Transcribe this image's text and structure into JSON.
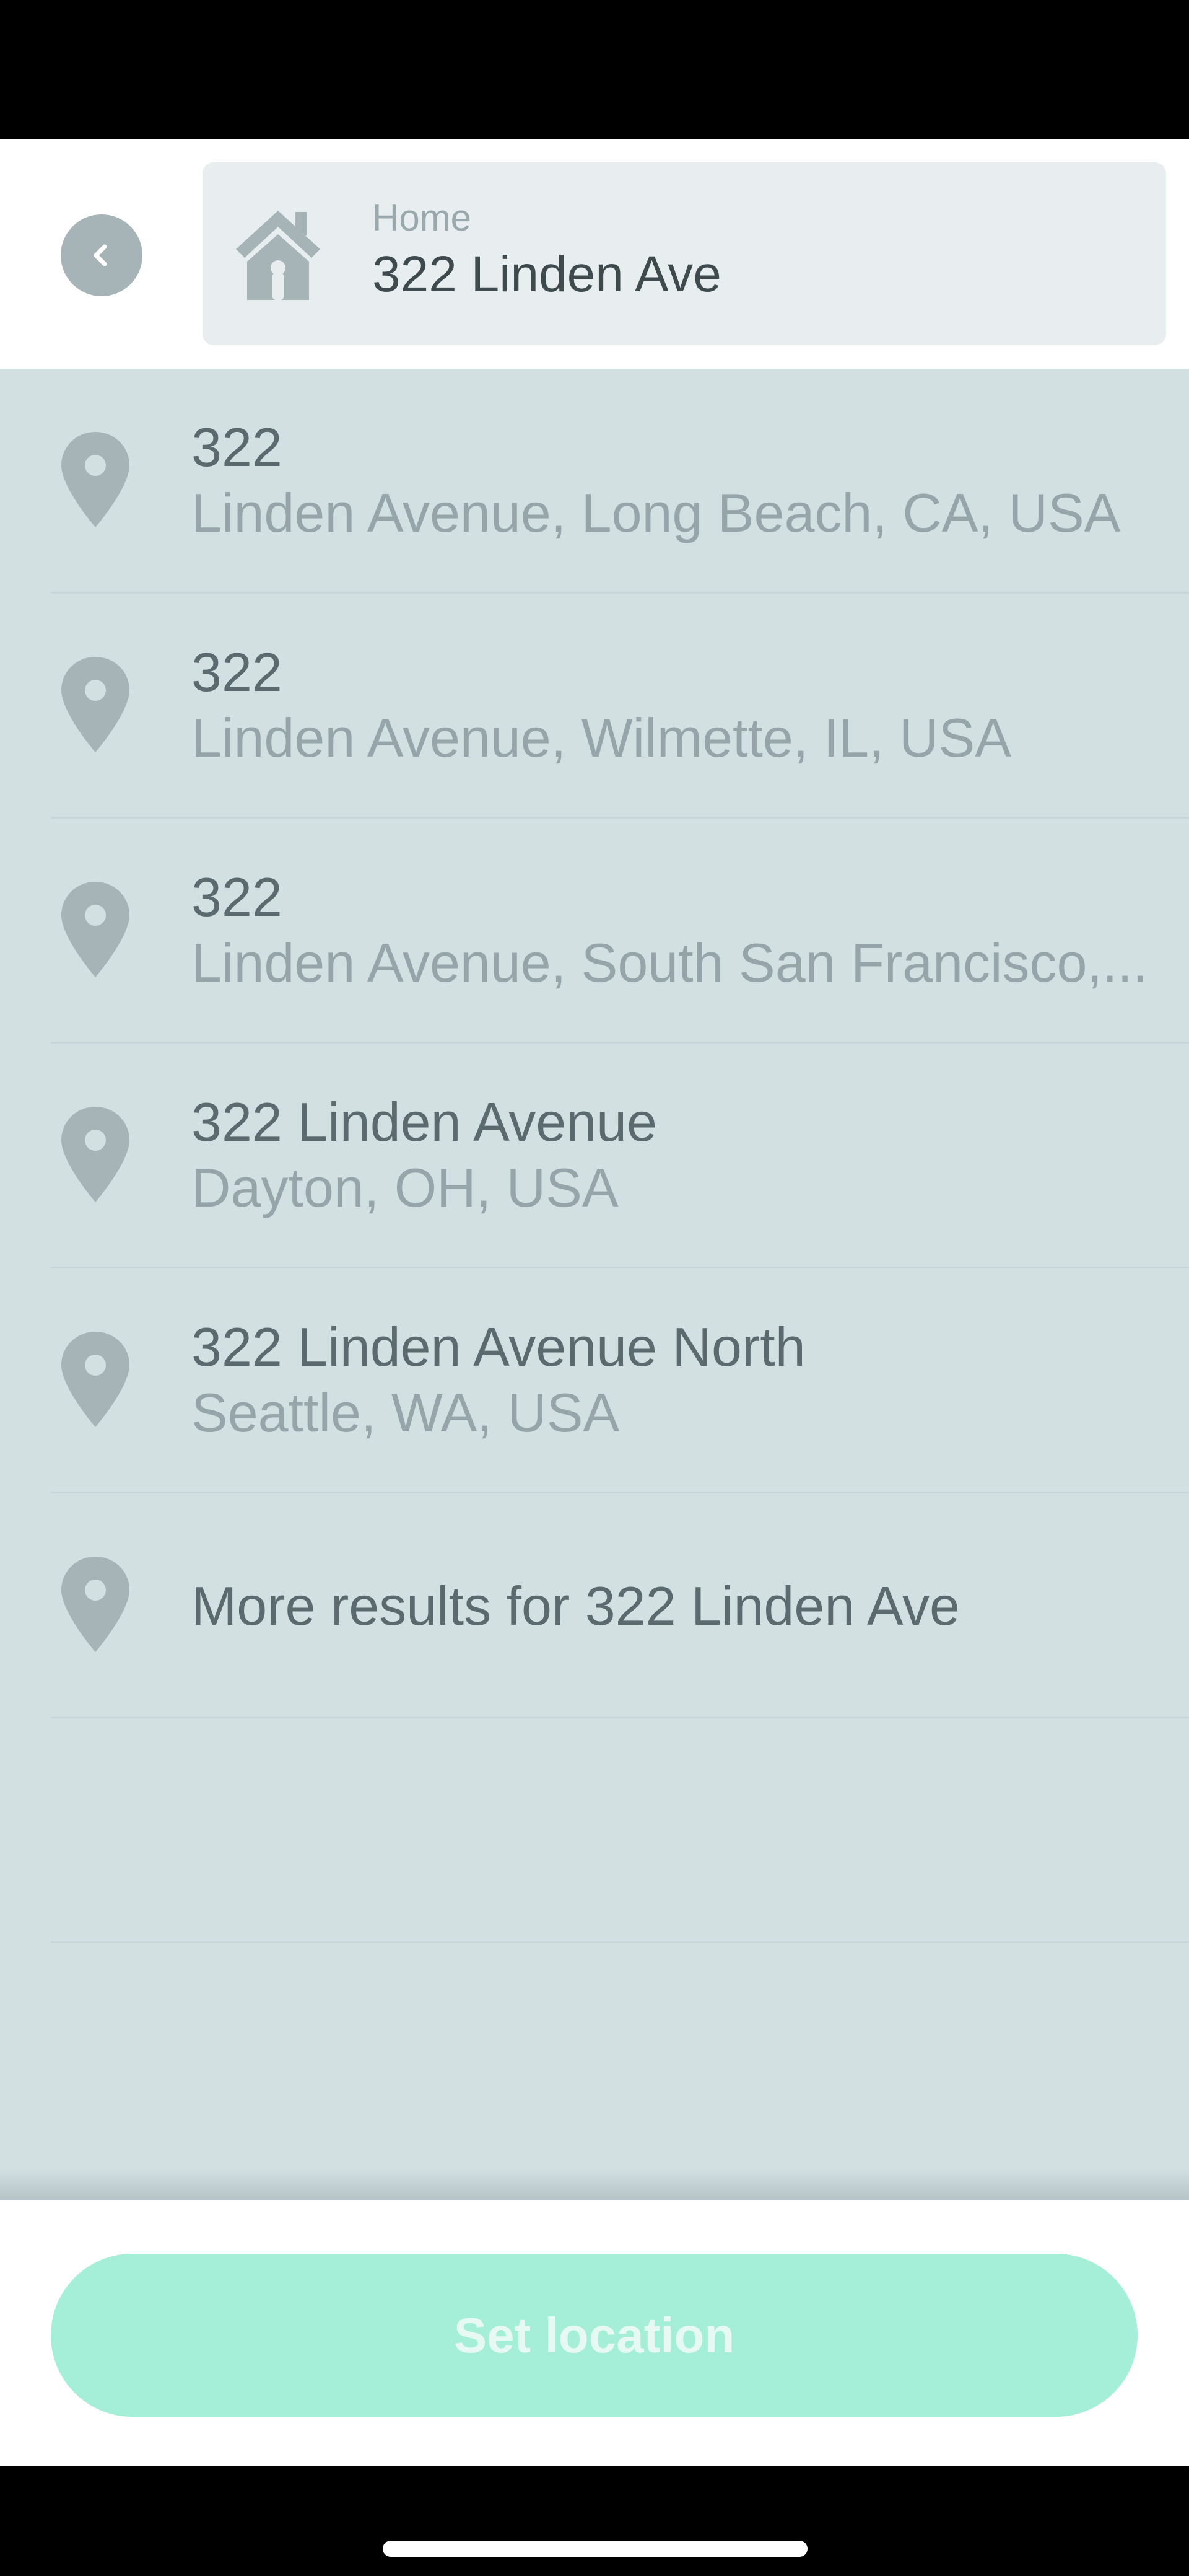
{
  "header": {
    "back_icon": "chevron-left-icon",
    "field_icon": "home-icon",
    "field_label": "Home",
    "field_value": "322 Linden Ave"
  },
  "results": [
    {
      "line1": "322",
      "line2": "Linden Avenue, Long Beach, CA, USA",
      "icon": "map-pin-icon"
    },
    {
      "line1": "322",
      "line2": "Linden Avenue, Wilmette, IL, USA",
      "icon": "map-pin-icon"
    },
    {
      "line1": "322",
      "line2": "Linden Avenue, South San Francisco,...",
      "icon": "map-pin-icon"
    },
    {
      "line1": "322 Linden Avenue",
      "line2": "Dayton, OH, USA",
      "icon": "map-pin-icon"
    },
    {
      "line1": "322 Linden Avenue North",
      "line2": "Seattle, WA, USA",
      "icon": "map-pin-icon"
    },
    {
      "line1": "More results for 322 Linden Ave",
      "line2": "",
      "icon": "map-pin-icon"
    }
  ],
  "footer": {
    "button_label": "Set location"
  },
  "colors": {
    "list_background": "#d2e0e2",
    "icon_gray": "#a6b4b8",
    "button_background": "#a5eed7",
    "button_text": "#e6f9f3"
  }
}
